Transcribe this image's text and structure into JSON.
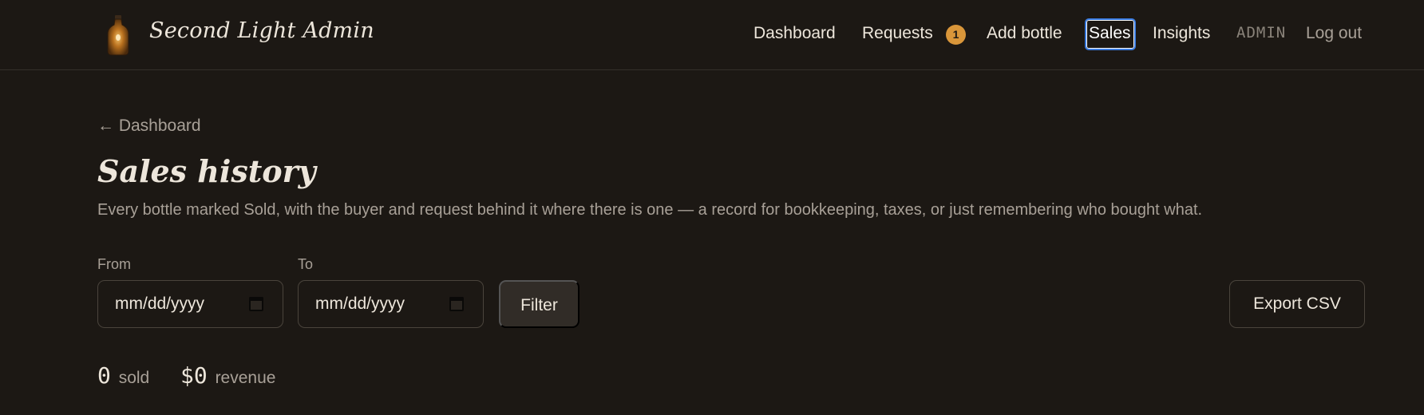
{
  "brand": {
    "name": "Second Light Admin",
    "logo_icon": "bottle-icon"
  },
  "nav": {
    "dashboard": "Dashboard",
    "requests": "Requests",
    "requests_badge": "1",
    "add_bottle": "Add bottle",
    "sales": "Sales",
    "insights": "Insights",
    "admin": "ADMIN",
    "logout": "Log out",
    "active": "Sales"
  },
  "page": {
    "back_link": "← Dashboard",
    "title": "Sales history",
    "subtitle": "Every bottle marked Sold, with the buyer and request behind it where there is one — a record for bookkeeping, taxes, or just remembering who bought what."
  },
  "filters": {
    "from_label": "From",
    "from_value": "mm/dd/yyyy",
    "to_label": "To",
    "to_value": "mm/dd/yyyy",
    "filter_button": "Filter",
    "export_button": "Export CSV"
  },
  "stats": {
    "sold_count": "0",
    "sold_label": "sold",
    "revenue_value": "$0",
    "revenue_label": "revenue"
  },
  "colors": {
    "background": "#1c1814",
    "accent_badge": "#d9963a",
    "focus_ring": "#3a7be0"
  }
}
